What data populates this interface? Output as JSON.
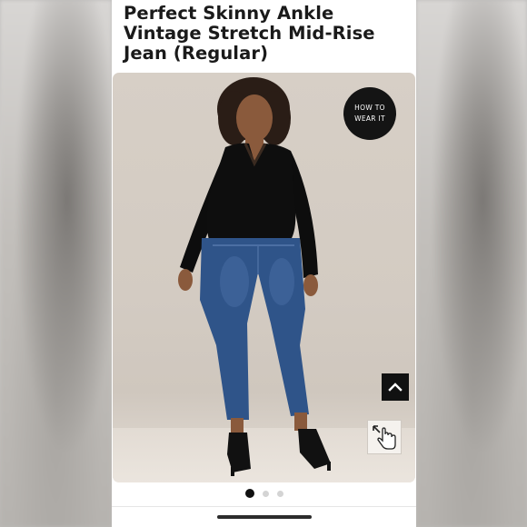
{
  "product": {
    "title": "Perfect Skinny Ankle Vintage Stretch Mid-Rise Jean (Regular)"
  },
  "gallery": {
    "how_to_label": "HOW TO WEAR IT",
    "back_to_top_icon": "chevron-up-icon",
    "zoom_icon": "pinch-zoom-icon",
    "page_count": 3,
    "active_index": 0
  },
  "colors": {
    "button_dark": "#141414",
    "dot_active": "#111111",
    "dot_inactive": "#d4d4d4"
  }
}
